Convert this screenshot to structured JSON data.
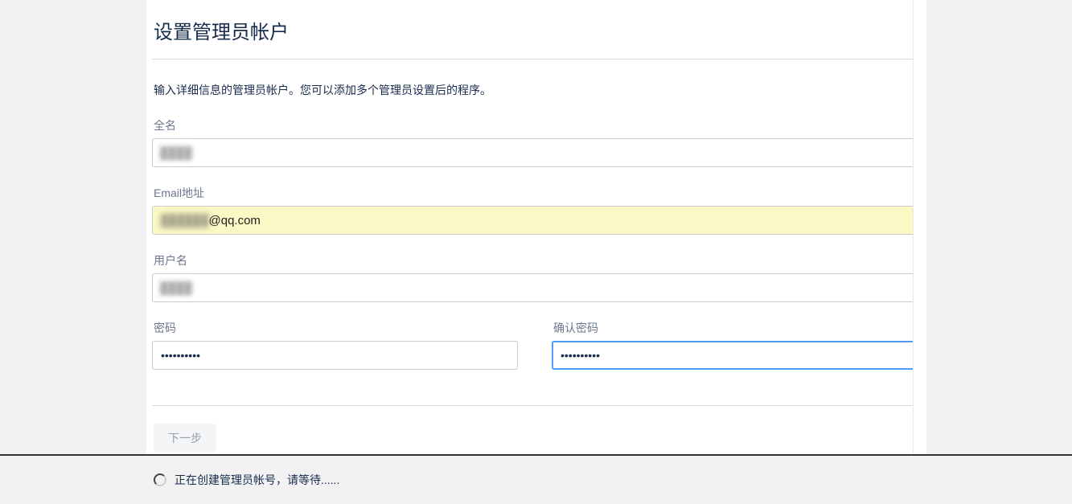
{
  "header": {
    "title": "设置管理员帐户",
    "intro": "输入详细信息的管理员帐户。您可以添加多个管理员设置后的程序。"
  },
  "form": {
    "fullname": {
      "label": "全名",
      "value_redacted": "████"
    },
    "email": {
      "label": "Email地址",
      "value_redacted_prefix": "██████",
      "value_visible_suffix": "@qq.com"
    },
    "username": {
      "label": "用户名",
      "value_redacted": "████"
    },
    "password": {
      "label": "密码",
      "value_masked": "••••••••••"
    },
    "confirm_password": {
      "label": "确认密码",
      "value_masked": "••••••••••"
    }
  },
  "actions": {
    "next_label": "下一步"
  },
  "status": {
    "creating_text": "正在创建管理员帐号，请等待......"
  }
}
